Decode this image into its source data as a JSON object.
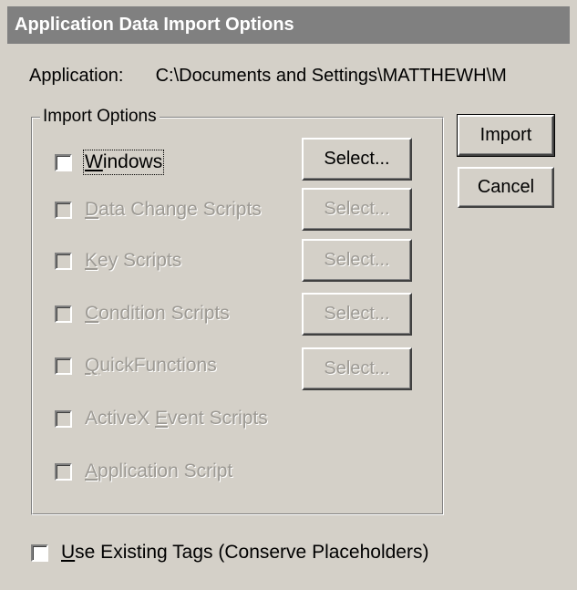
{
  "window": {
    "title": "Application Data Import Options"
  },
  "application": {
    "label": "Application:",
    "path": "C:\\Documents and Settings\\MATTHEWH\\M"
  },
  "import_options": {
    "group_label": "Import Options",
    "items": [
      {
        "pre": "",
        "key": "W",
        "post": "indows",
        "checked": false,
        "enabled": true,
        "select_label": "Select..."
      },
      {
        "pre": "",
        "key": "D",
        "post": "ata Change Scripts",
        "checked": false,
        "enabled": false,
        "select_label": "Select..."
      },
      {
        "pre": "",
        "key": "K",
        "post": "ey Scripts",
        "checked": false,
        "enabled": false,
        "select_label": "Select..."
      },
      {
        "pre": "",
        "key": "C",
        "post": "ondition Scripts",
        "checked": false,
        "enabled": false,
        "select_label": "Select..."
      },
      {
        "pre": "",
        "key": "Q",
        "post": "uickFunctions",
        "checked": false,
        "enabled": false,
        "select_label": "Select..."
      },
      {
        "pre": "ActiveX ",
        "key": "E",
        "post": "vent Scripts",
        "checked": false,
        "enabled": false
      },
      {
        "pre": "",
        "key": "A",
        "post": "pplication Script",
        "checked": false,
        "enabled": false
      }
    ]
  },
  "buttons": {
    "import": "Import",
    "cancel": "Cancel"
  },
  "use_existing_tags": {
    "pre": "",
    "key": "U",
    "post": "se Existing Tags (Conserve Placeholders)",
    "checked": false
  }
}
